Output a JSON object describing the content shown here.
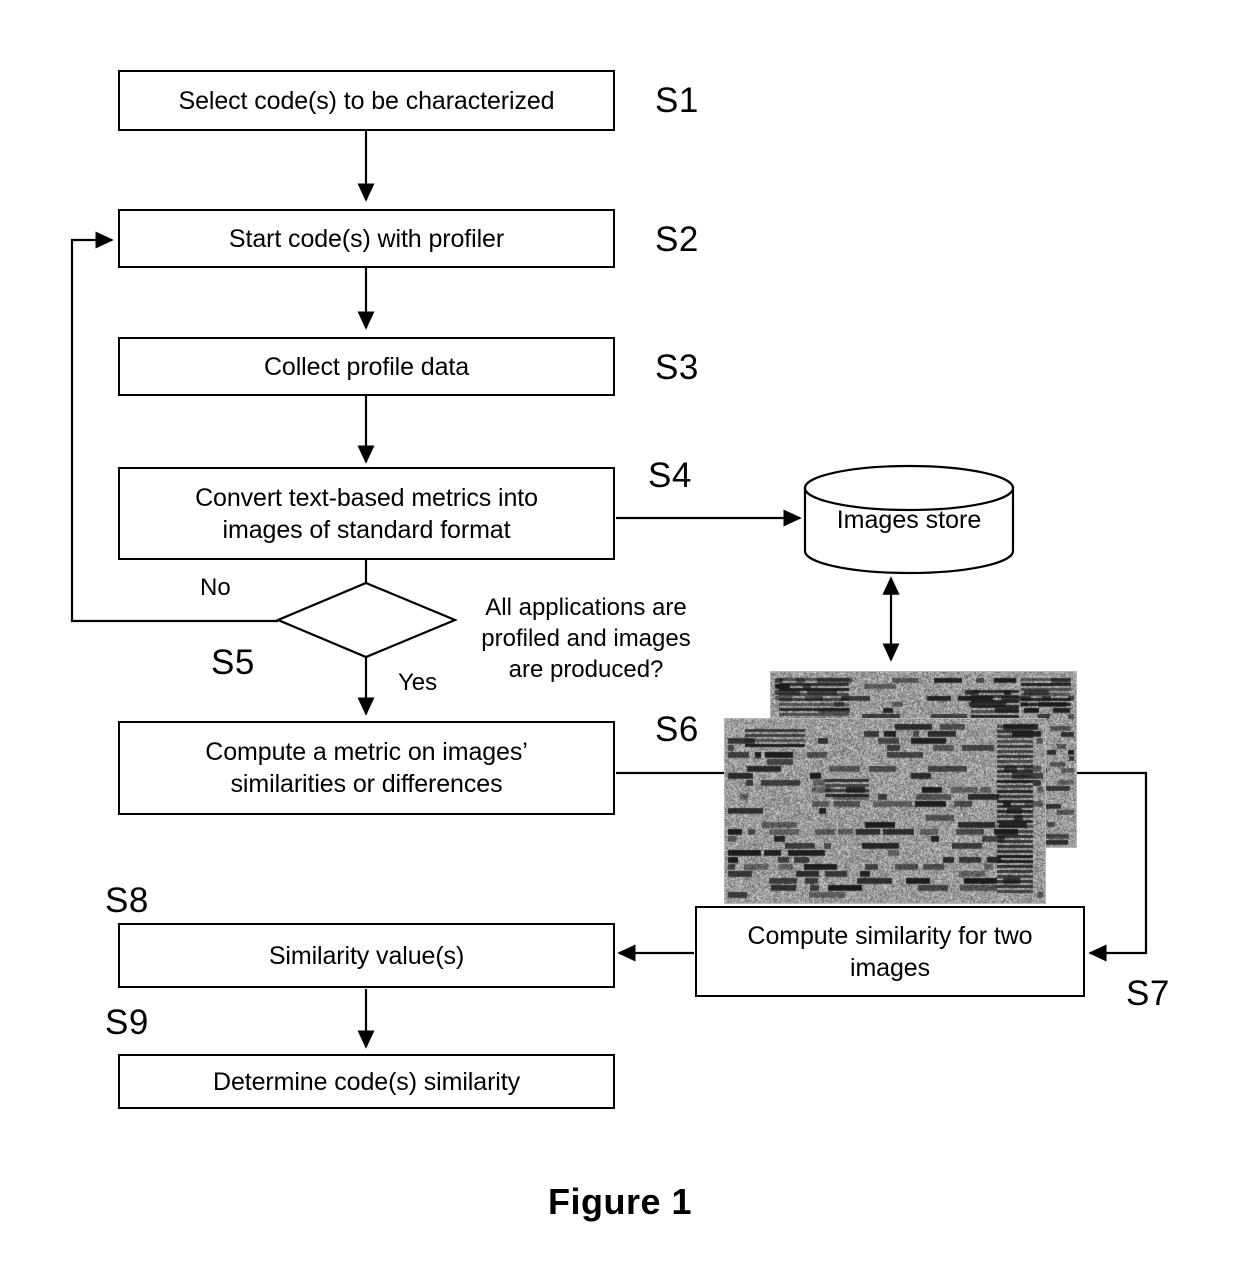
{
  "figure": {
    "caption": "Figure 1"
  },
  "nodes": [
    {
      "id": "s1",
      "step": "S1",
      "text": "Select code(s) to be characterized"
    },
    {
      "id": "s2",
      "step": "S2",
      "text": "Start code(s) with profiler"
    },
    {
      "id": "s3",
      "step": "S3",
      "text": "Collect profile data"
    },
    {
      "id": "s4",
      "step": "S4",
      "text": "Convert text-based metrics into images of standard format"
    },
    {
      "id": "s5",
      "step": "S5",
      "text": "All applications are profiled and images are produced?"
    },
    {
      "id": "s6",
      "step": "S6",
      "text": "Compute a metric on images’ similarities or differences"
    },
    {
      "id": "s7",
      "step": "S7",
      "text": "Compute similarity for two images"
    },
    {
      "id": "s8",
      "step": "S8",
      "text": "Similarity value(s)"
    },
    {
      "id": "s9",
      "step": "S9",
      "text": "Determine code(s) similarity"
    }
  ],
  "boxes": {
    "s1_text": "Select code(s) to be characterized",
    "s2_text": "Start code(s) with profiler",
    "s3_text": "Collect profile data",
    "s4_line1": "Convert text-based metrics into",
    "s4_line2": "images of standard format",
    "s6_line1": "Compute a metric on images’",
    "s6_line2": "similarities or differences",
    "s7_line1": "Compute similarity for two",
    "s7_line2": "images",
    "s8_text": "Similarity value(s)",
    "s9_text": "Determine code(s) similarity"
  },
  "step_labels": {
    "s1": "S1",
    "s2": "S2",
    "s3": "S3",
    "s4": "S4",
    "s5": "S5",
    "s6": "S6",
    "s7": "S7",
    "s8": "S8",
    "s9": "S9"
  },
  "decision": {
    "condition_line1": "All applications are",
    "condition_line2": "profiled and images",
    "condition_line3": "are produced?",
    "branch_no": "No",
    "branch_yes": "Yes"
  },
  "datastore": {
    "label": "Images store"
  },
  "colors": {
    "stroke": "#000000",
    "background": "#ffffff",
    "thumbnail_base": "#c8c8c8",
    "thumbnail_ink": "#1a1a1a"
  }
}
